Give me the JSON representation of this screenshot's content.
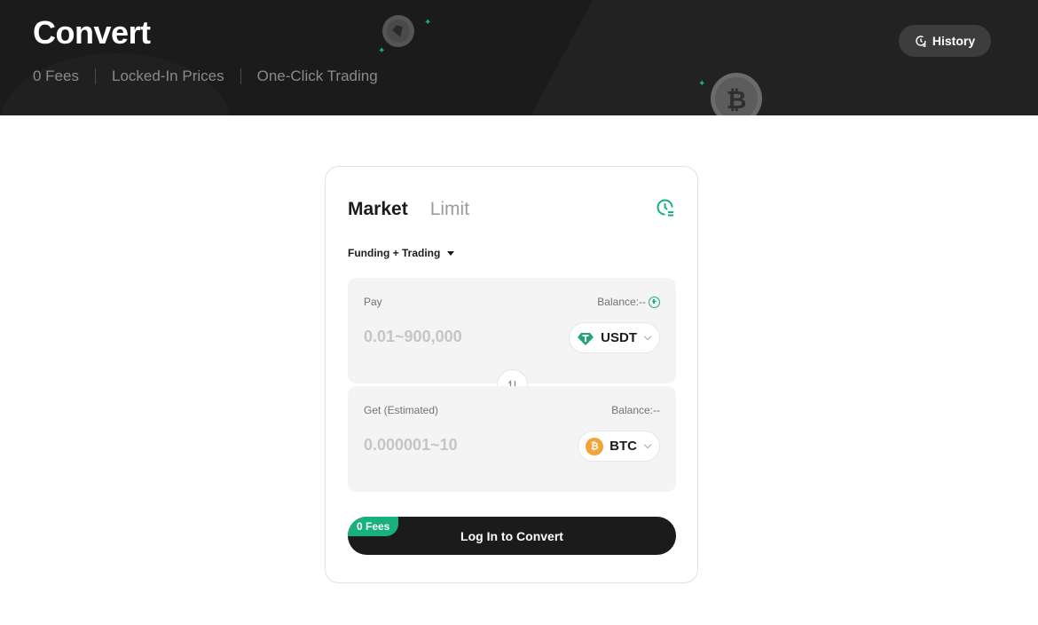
{
  "header": {
    "title": "Convert",
    "features": [
      "0 Fees",
      "Locked-In Prices",
      "One-Click Trading"
    ],
    "history_label": "History"
  },
  "card": {
    "tabs": [
      {
        "label": "Market",
        "active": true
      },
      {
        "label": "Limit",
        "active": false
      }
    ],
    "account_selector": "Funding + Trading",
    "pay": {
      "label": "Pay",
      "balance": "Balance:--",
      "placeholder": "0.01~900,000",
      "coin": "USDT"
    },
    "get": {
      "label": "Get (Estimated)",
      "balance": "Balance:--",
      "placeholder": "0.000001~10",
      "coin": "BTC"
    },
    "convert_button": "Log In to Convert",
    "fees_badge": "0 Fees"
  },
  "colors": {
    "accent": "#18b07b",
    "banner": "#1b1b1b",
    "btc": "#f2a33a"
  }
}
